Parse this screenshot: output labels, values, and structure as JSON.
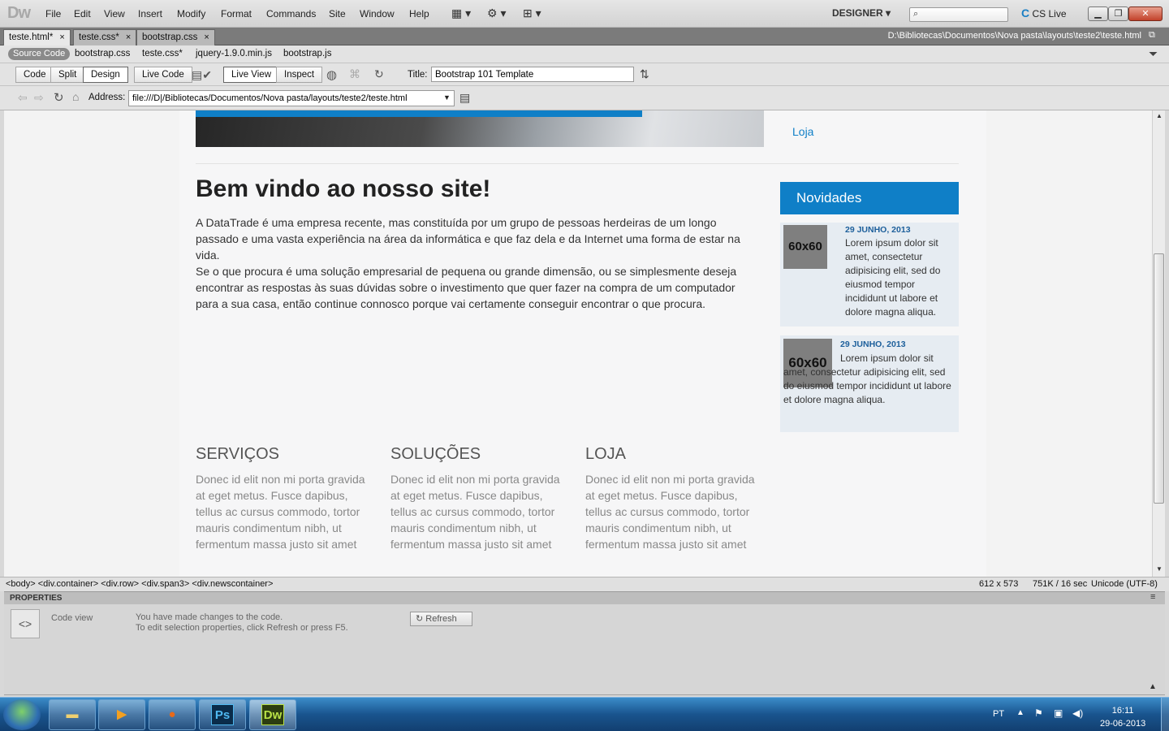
{
  "app": {
    "logo": "Dw",
    "menus": [
      "File",
      "Edit",
      "View",
      "Insert",
      "Modify",
      "Format",
      "Commands",
      "Site",
      "Window",
      "Help"
    ],
    "workspace": "DESIGNER",
    "cslive": "CS Live",
    "search_placeholder": ""
  },
  "doc_tabs": [
    {
      "label": "teste.html*",
      "close": "×"
    },
    {
      "label": "teste.css*",
      "close": "×"
    },
    {
      "label": "bootstrap.css",
      "close": "×"
    }
  ],
  "file_path": "D:\\Bibliotecas\\Documentos\\Nova pasta\\layouts\\teste2\\teste.html",
  "related_files": {
    "source_code": "Source Code",
    "files": [
      "bootstrap.css",
      "teste.css*",
      "jquery-1.9.0.min.js",
      "bootstrap.js"
    ]
  },
  "doc_toolbar": {
    "code": "Code",
    "split": "Split",
    "design": "Design",
    "live_code": "Live Code",
    "live_view": "Live View",
    "inspect": "Inspect",
    "title_label": "Title:",
    "title_value": "Bootstrap 101 Template"
  },
  "nav": {
    "address_label": "Address:",
    "address_value": "file:///D|/Bibliotecas/Documentos/Nova pasta/layouts/teste2/teste.html"
  },
  "page": {
    "side_link": "Loja",
    "heading": "Bem vindo ao nosso site!",
    "intro_p1": "A DataTrade é uma empresa recente, mas constituída por um grupo de pessoas herdeiras de um longo passado e uma vasta experiência na área da informática e que faz dela e da Internet uma forma de estar na vida.",
    "intro_p2": "Se o que procura é uma solução empresarial de pequena ou grande dimensão, ou se simplesmente deseja encontrar as respostas às suas dúvidas sobre o investimento que quer fazer na compra de um computador para a sua casa, então continue connosco porque vai certamente conseguir encontrar o que procura.",
    "news_title": "Novidades",
    "news": [
      {
        "thumb": "60x60",
        "date": "29 JUNHO, 2013",
        "text": "Lorem ipsum dolor sit amet, consectetur adipisicing elit, sed do eiusmod tempor incididunt ut labore et dolore magna aliqua."
      },
      {
        "thumb": "60x60",
        "date": "29 JUNHO, 2013",
        "text": "Lorem ipsum dolor sit amet, consectetur adipisicing elit, sed do eiusmod tempor incididunt ut labore et dolore magna aliqua."
      }
    ],
    "columns": [
      {
        "title": "SERVIÇOS",
        "text": "Donec id elit non mi porta gravida at eget metus. Fusce dapibus, tellus ac cursus commodo, tortor mauris condimentum nibh, ut fermentum massa justo sit amet"
      },
      {
        "title": "SOLUÇÕES",
        "text": "Donec id elit non mi porta gravida at eget metus. Fusce dapibus, tellus ac cursus commodo, tortor mauris condimentum nibh, ut fermentum massa justo sit amet"
      },
      {
        "title": "LOJA",
        "text": "Donec id elit non mi porta gravida at eget metus. Fusce dapibus, tellus ac cursus commodo, tortor mauris condimentum nibh, ut fermentum massa justo sit amet"
      }
    ]
  },
  "status": {
    "tag_selector": "<body> <div.container> <div.row> <div.span3> <div.newscontainer>",
    "window_size": "612 x 573",
    "download": "751K / 16 sec",
    "encoding": "Unicode (UTF-8)"
  },
  "properties": {
    "title": "PROPERTIES",
    "code_view": "Code view",
    "msg1": "You have made changes to the code.",
    "msg2": "To edit selection properties, click Refresh or press F5.",
    "refresh": "Refresh"
  },
  "taskbar": {
    "language": "PT",
    "time": "16:11",
    "date": "29-06-2013",
    "apps": [
      "explorer",
      "media-player",
      "firefox",
      "Ps",
      "Dw"
    ]
  }
}
